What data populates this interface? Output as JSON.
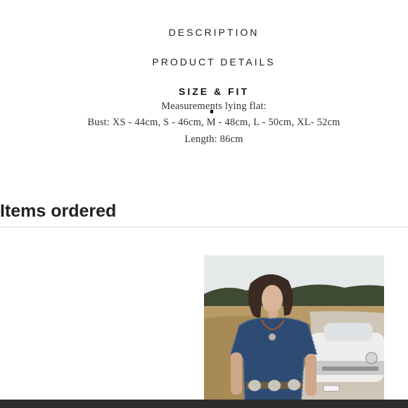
{
  "tabs": {
    "description": "DESCRIPTION",
    "product_details": "PRODUCT DETAILS",
    "size_fit": "SIZE & FIT"
  },
  "size_fit": {
    "line1": "Measurements lying flat:",
    "line2": "Bust: XS - 44cm, S - 46cm, M - 48cm, L - 50cm, XL- 52cm",
    "line3": "Length: 86cm"
  },
  "order": {
    "title": "Items ordered"
  },
  "colors": {
    "background": "#ffffff",
    "text": "#222222",
    "divider": "#dcdcdc",
    "bottom_bar": "#2b2b2b"
  }
}
